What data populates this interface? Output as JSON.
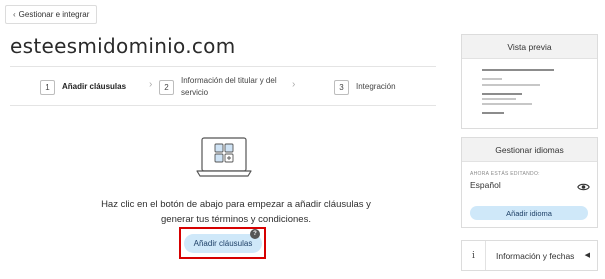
{
  "header": {
    "back_label": "Gestionar e integrar",
    "back_icon": "chevron-left-icon",
    "title": "esteesmidominio.com"
  },
  "stepper": {
    "steps": [
      {
        "number": "1",
        "label": "Añadir cláusulas",
        "active": true
      },
      {
        "number": "2",
        "label_line1": "Información del titular y del",
        "label_line2": "servicio",
        "active": false
      },
      {
        "number": "3",
        "label": "Integración",
        "active": false
      }
    ],
    "arrow_icon": "chevron-right-icon"
  },
  "main": {
    "empty_state_icon": "laptop-grid-add-icon",
    "empty_line1": "Haz clic en el botón de abajo para empezar a añadir cláusulas y",
    "empty_line2": "generar tus términos y condiciones.",
    "add_button_label": "Añadir cláusulas",
    "help_badge": "?",
    "highlight_color": "#d60000"
  },
  "sidebar": {
    "preview": {
      "title": "Vista previa"
    },
    "languages": {
      "title": "Gestionar idiomas",
      "caption": "AHORA ESTÁS EDITANDO:",
      "current_language": "Español",
      "eye_icon": "eye-icon",
      "add_language_label": "Añadir idioma"
    },
    "info": {
      "icon_glyph": "i",
      "label": "Información y fechas",
      "caret_icon": "caret-left-icon"
    }
  },
  "colors": {
    "button_bg": "#cfe8f9",
    "button_text": "#1d3f66",
    "panel_header_bg": "#f2f2f2"
  }
}
